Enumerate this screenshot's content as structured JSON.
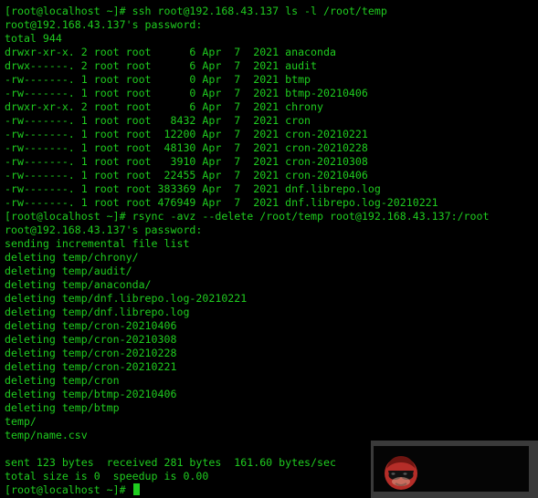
{
  "terminal": {
    "lines": [
      "[root@localhost ~]# ssh root@192.168.43.137 ls -l /root/temp",
      "root@192.168.43.137's password:",
      "total 944",
      "drwxr-xr-x. 2 root root      6 Apr  7  2021 anaconda",
      "drwx------. 2 root root      6 Apr  7  2021 audit",
      "-rw-------. 1 root root      0 Apr  7  2021 btmp",
      "-rw-------. 1 root root      0 Apr  7  2021 btmp-20210406",
      "drwxr-xr-x. 2 root root      6 Apr  7  2021 chrony",
      "-rw-------. 1 root root   8432 Apr  7  2021 cron",
      "-rw-------. 1 root root  12200 Apr  7  2021 cron-20210221",
      "-rw-------. 1 root root  48130 Apr  7  2021 cron-20210228",
      "-rw-------. 1 root root   3910 Apr  7  2021 cron-20210308",
      "-rw-------. 1 root root  22455 Apr  7  2021 cron-20210406",
      "-rw-------. 1 root root 383369 Apr  7  2021 dnf.librepo.log",
      "-rw-------. 1 root root 476949 Apr  7  2021 dnf.librepo.log-20210221",
      "[root@localhost ~]# rsync -avz --delete /root/temp root@192.168.43.137:/root",
      "root@192.168.43.137's password:",
      "sending incremental file list",
      "deleting temp/chrony/",
      "deleting temp/audit/",
      "deleting temp/anaconda/",
      "deleting temp/dnf.librepo.log-20210221",
      "deleting temp/dnf.librepo.log",
      "deleting temp/cron-20210406",
      "deleting temp/cron-20210308",
      "deleting temp/cron-20210228",
      "deleting temp/cron-20210221",
      "deleting temp/cron",
      "deleting temp/btmp-20210406",
      "deleting temp/btmp",
      "temp/",
      "temp/name.csv",
      "",
      "sent 123 bytes  received 281 bytes  161.60 bytes/sec",
      "total size is 0  speedup is 0.00"
    ],
    "prompt": "[root@localhost ~]# "
  },
  "overlay": {
    "avatar_icon": "sunglasses-face-icon"
  },
  "colors": {
    "background": "#000000",
    "text": "#1fcc1f",
    "overlay_frame": "#3a3a3a",
    "avatar": "#c0322d"
  }
}
